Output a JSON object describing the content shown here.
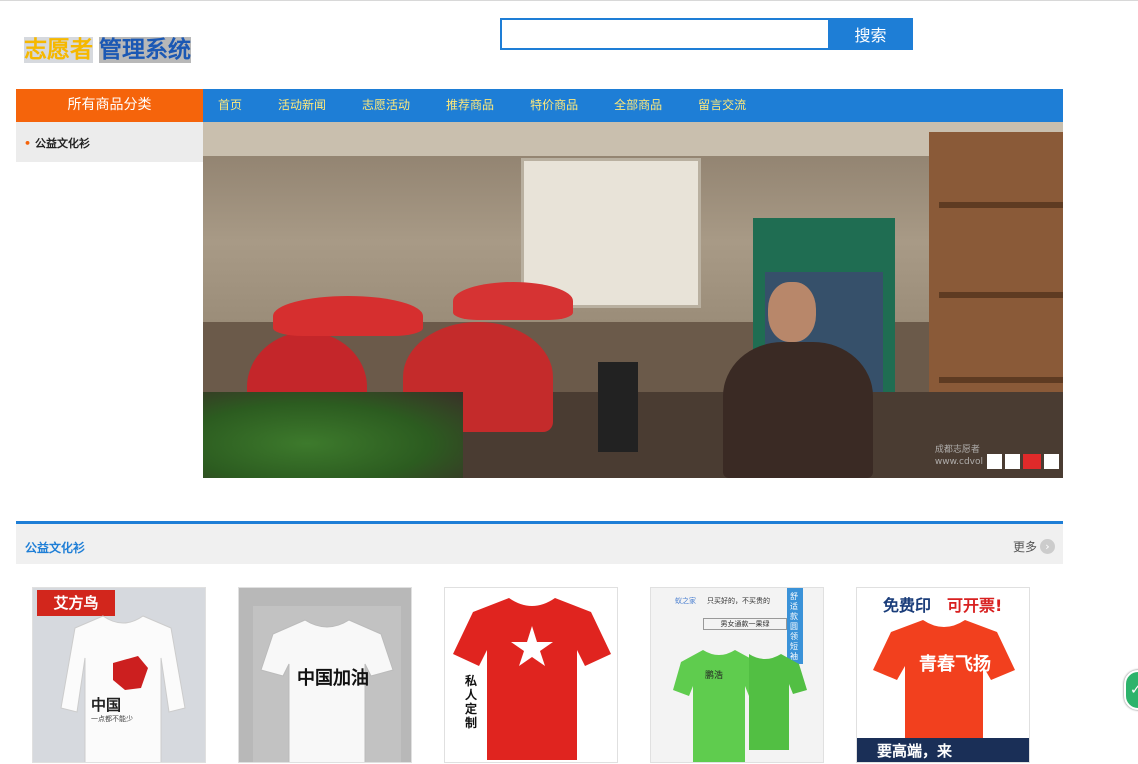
{
  "header": {
    "logo_part1": "志愿者",
    "logo_part2": "管理系统",
    "search_placeholder": "",
    "search_button": "搜索"
  },
  "nav": {
    "category_header": "所有商品分类",
    "items": [
      {
        "label": "首页"
      },
      {
        "label": "活动新闻"
      },
      {
        "label": "志愿活动"
      },
      {
        "label": "推荐商品"
      },
      {
        "label": "特价商品"
      },
      {
        "label": "全部商品"
      },
      {
        "label": "留言交流"
      }
    ]
  },
  "categories": [
    {
      "label": "公益文化衫"
    }
  ],
  "banner": {
    "watermark_line1": "成都志愿者",
    "watermark_line2": "www.cdvol",
    "slides": 4,
    "active_slide": 3
  },
  "section": {
    "title": "公益文化衫",
    "more": "更多"
  },
  "products": [
    {
      "tag": "艾方鸟",
      "print": "中国",
      "sub": "一点都不能少"
    },
    {
      "print": "中国加油"
    },
    {
      "side_text": "私人定制"
    },
    {
      "brand": "蚁之家",
      "slogan": "只买好的，不买贵的",
      "banner": "男女通款一果绿",
      "badge": "舒适款圆领短袖",
      "print": "鹏浩"
    },
    {
      "top_text1": "免费印",
      "top_text2": "可开票!",
      "bottom_text": "要高端，来",
      "print": "青春飞扬"
    }
  ],
  "colors": {
    "primary_blue": "#1e7ed6",
    "category_orange": "#f5640b",
    "nav_text_yellow": "#ffe97a",
    "logo_yellow": "#f6b800",
    "logo_blue": "#1b58b4"
  }
}
